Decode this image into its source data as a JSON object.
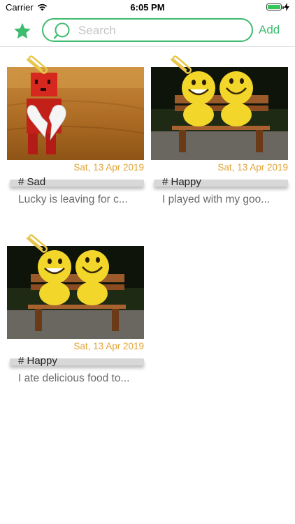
{
  "status_bar": {
    "carrier": "Carrier",
    "time": "6:05 PM"
  },
  "nav": {
    "search_placeholder": "Search",
    "add_label": "Add"
  },
  "colors": {
    "accent": "#3dbb6e",
    "date": "#e0a437"
  },
  "entries": [
    {
      "date": "Sat, 13 Apr 2019",
      "tag": "# Sad",
      "preview": "Lucky is leaving for c...",
      "image": "red-robot-broken-heart"
    },
    {
      "date": "Sat, 13 Apr 2019",
      "tag": "# Happy",
      "preview": "I played with my goo...",
      "image": "smiley-plush-bench"
    },
    {
      "date": "Sat, 13 Apr 2019",
      "tag": "# Happy",
      "preview": "I ate delicious food to...",
      "image": "smiley-plush-bench"
    }
  ]
}
